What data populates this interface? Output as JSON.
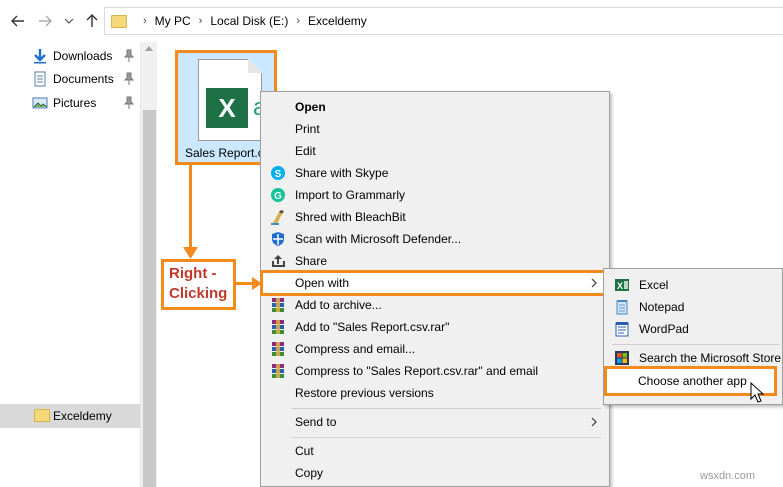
{
  "address": {
    "crumbs": [
      "My PC",
      "Local Disk (E:)",
      "Exceldemy"
    ]
  },
  "sidebar": {
    "quick_access": [
      {
        "label": "Downloads",
        "icon": "download-arrow-icon"
      },
      {
        "label": "Documents",
        "icon": "documents-icon"
      },
      {
        "label": "Pictures",
        "icon": "pictures-icon"
      }
    ],
    "selected": {
      "label": "Exceldemy",
      "icon": "folder-icon"
    }
  },
  "file": {
    "name": "Sales Report.csv",
    "icon_letter": "X",
    "icon_glyph": "a,"
  },
  "callout": {
    "line1": "Right -",
    "line2": "Clicking"
  },
  "context_menu": {
    "items": [
      {
        "label": "Open",
        "bold": true,
        "icon": ""
      },
      {
        "label": "Print",
        "icon": ""
      },
      {
        "label": "Edit",
        "icon": ""
      },
      {
        "label": "Share with Skype",
        "icon": "skype-icon"
      },
      {
        "label": "Import to Grammarly",
        "icon": "grammarly-icon"
      },
      {
        "label": "Shred with BleachBit",
        "icon": "bleachbit-icon"
      },
      {
        "label": "Scan with Microsoft Defender...",
        "icon": "defender-shield-icon"
      },
      {
        "label": "Share",
        "icon": "share-icon"
      },
      {
        "label": "Open with",
        "icon": "",
        "submenu": true
      },
      {
        "label": "Add to archive...",
        "icon": "winrar-icon"
      },
      {
        "label": "Add to \"Sales Report.csv.rar\"",
        "icon": "winrar-icon"
      },
      {
        "label": "Compress and email...",
        "icon": "winrar-icon"
      },
      {
        "label": "Compress to \"Sales Report.csv.rar\" and email",
        "icon": "winrar-icon"
      },
      {
        "label": "Restore previous versions",
        "icon": ""
      },
      {
        "label": "Send to",
        "icon": "",
        "submenu": true
      },
      {
        "label": "Cut",
        "icon": ""
      },
      {
        "label": "Copy",
        "icon": ""
      }
    ]
  },
  "open_with_submenu": {
    "items": [
      {
        "label": "Excel",
        "icon": "excel-icon"
      },
      {
        "label": "Notepad",
        "icon": "notepad-icon"
      },
      {
        "label": "WordPad",
        "icon": "wordpad-icon"
      },
      {
        "label": "Search the Microsoft Store",
        "icon": "store-icon"
      },
      {
        "label": "Choose another app",
        "icon": ""
      }
    ]
  },
  "watermark": "wsxdn.com",
  "colors": {
    "highlight": "#f28b1c",
    "callout_text": "#c0392b",
    "selection": "#cce8ff",
    "menu_bg": "#f0f0f0",
    "excel_green": "#1e7145"
  }
}
